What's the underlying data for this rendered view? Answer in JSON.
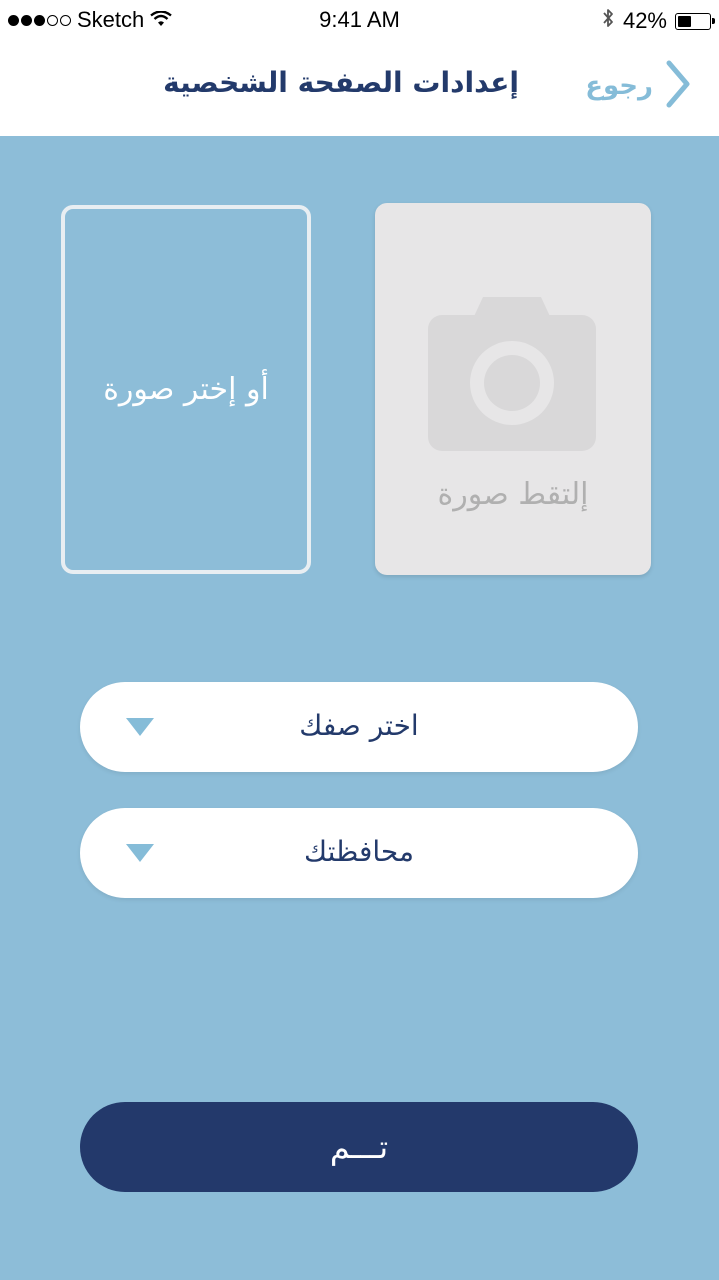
{
  "status_bar": {
    "carrier": "Sketch",
    "time": "9:41 AM",
    "battery": "42%",
    "battery_level": 0.42,
    "signal_bars_filled": 3,
    "signal_bars_total": 5,
    "icons": [
      "wifi-icon",
      "bluetooth-icon",
      "battery-icon"
    ]
  },
  "nav": {
    "title": "إعدادات الصفحة الشخصية",
    "back_label": "رجوع",
    "back_icon": "chevron-right-icon"
  },
  "photo": {
    "pick_label": "أو إختر صورة",
    "take_label": "إلتقط صورة",
    "camera_icon": "camera-icon"
  },
  "form": {
    "grade_select": {
      "label": "اختر صفك",
      "icon": "chevron-down-icon"
    },
    "governorate_select": {
      "label": "محافظتك",
      "icon": "chevron-down-icon"
    }
  },
  "actions": {
    "done_label": "تـــم"
  },
  "colors": {
    "background": "#8dbdd8",
    "primary": "#233a6b",
    "accent": "#85bcd8",
    "card_gray": "#e7e6e7",
    "white": "#ffffff"
  }
}
